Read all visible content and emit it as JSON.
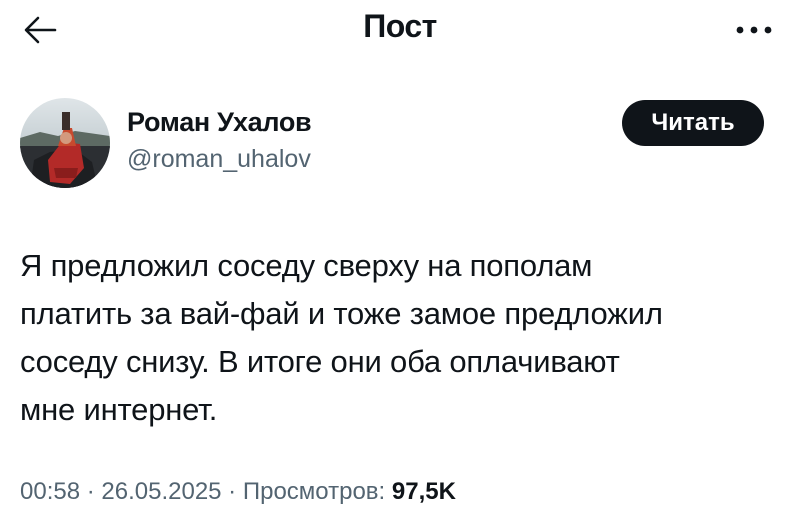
{
  "header": {
    "title": "Пост",
    "back_icon": "arrow-left-icon",
    "more_icon": "more-horizontal-icon"
  },
  "author": {
    "name": "Роман Ухалов",
    "handle": "@roman_uhalov",
    "avatar_icon": "avatar-photo"
  },
  "follow_button": {
    "label": "Читать",
    "background": "#0f1419",
    "color": "#ffffff"
  },
  "post": {
    "lines": [
      "Я предложил соседу сверху на пополам",
      "платить за вай-фай и тоже замое предложил",
      "соседу снизу. В итоге они оба оплачивают",
      "мне интернет."
    ]
  },
  "meta": {
    "time": "00:58",
    "separator": " · ",
    "date": "26.05.2025",
    "views_label": "Просмотров: ",
    "views_count": "97,5K"
  },
  "colors": {
    "text_primary": "#0f1419",
    "text_secondary": "#536471",
    "background": "#ffffff"
  }
}
